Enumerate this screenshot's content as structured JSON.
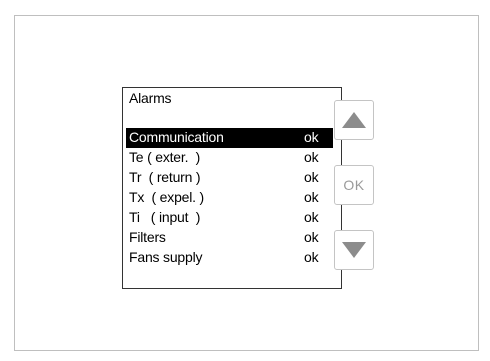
{
  "screen": {
    "title": "Alarms",
    "alarms": [
      {
        "name": "Communication",
        "status": "ok",
        "selected": true
      },
      {
        "name": "Te ( exter.  )",
        "status": "ok",
        "selected": false
      },
      {
        "name": "Tr  ( return )",
        "status": "ok",
        "selected": false
      },
      {
        "name": "Tx  ( expel. )",
        "status": "ok",
        "selected": false
      },
      {
        "name": "Ti   ( input  )",
        "status": "ok",
        "selected": false
      },
      {
        "name": "Filters",
        "status": "ok",
        "selected": false
      },
      {
        "name": "Fans supply",
        "status": "ok",
        "selected": false
      }
    ]
  },
  "buttons": {
    "up_icon": "triangle-up-icon",
    "ok_label": "OK",
    "down_icon": "triangle-down-icon"
  },
  "colors": {
    "selection_background": "#000000",
    "selection_text": "#ffffff",
    "button_icon": "#8c8c8c"
  }
}
